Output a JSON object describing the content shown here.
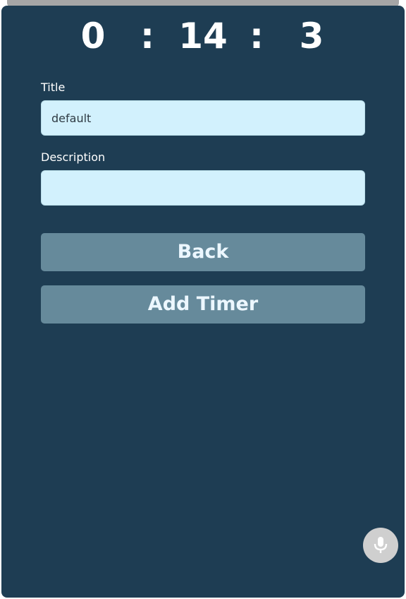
{
  "timer": {
    "minutes": "0",
    "sep1": ":",
    "seconds": "14",
    "sep2": ":",
    "tenths": "3"
  },
  "form": {
    "title_label": "Title",
    "title_value": "default",
    "description_label": "Description",
    "description_value": ""
  },
  "buttons": {
    "back_label": "Back",
    "add_timer_label": "Add Timer"
  },
  "icons": {
    "mic": "microphone-icon"
  },
  "colors": {
    "panel_bg": "#1e3d53",
    "input_bg": "#d2f1fd",
    "button_bg": "#668a9b",
    "mic_bg": "#cfcfcf"
  }
}
